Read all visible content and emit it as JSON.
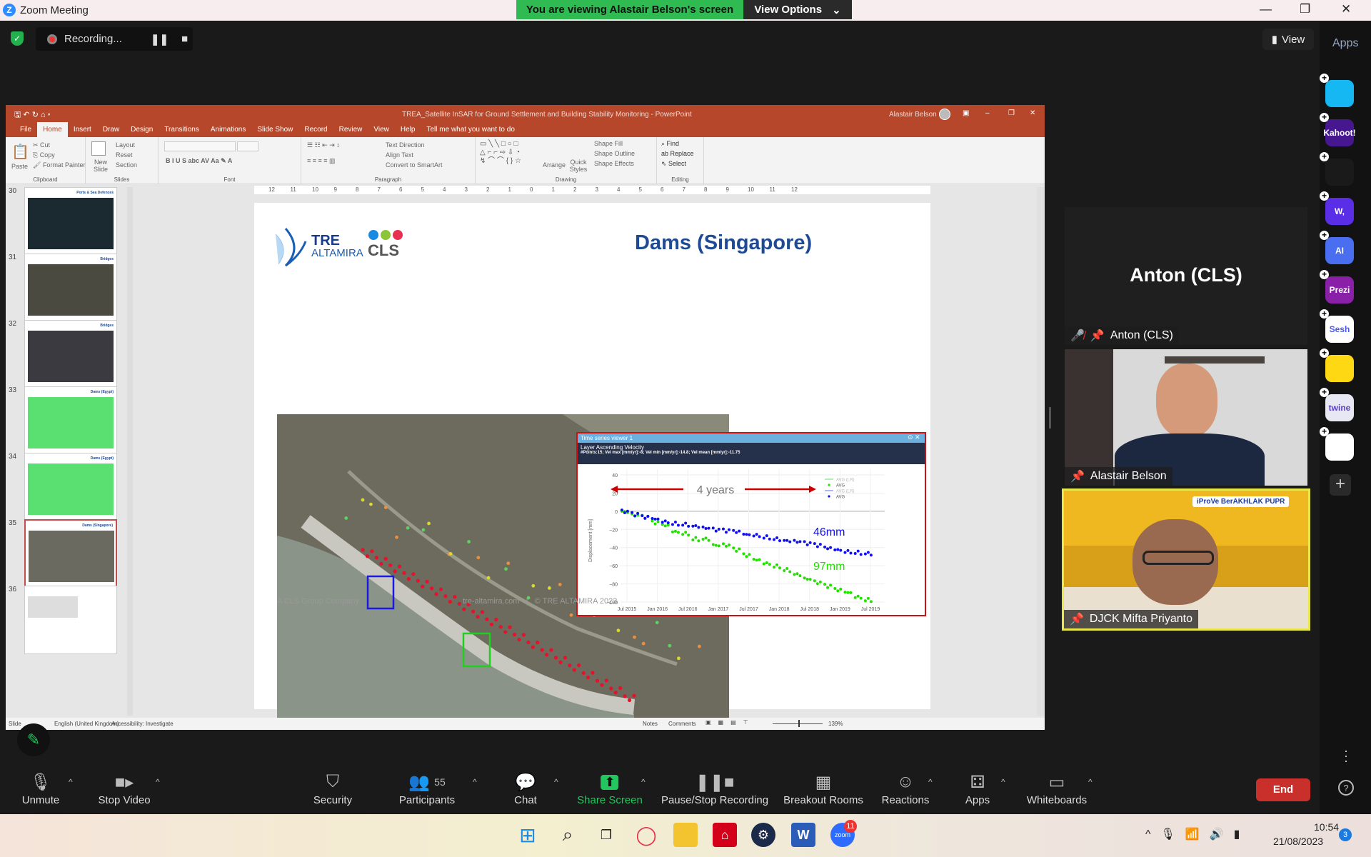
{
  "zoom": {
    "window_title": "Zoom Meeting",
    "banner": "You are viewing Alastair Belson's screen",
    "view_options": "View Options",
    "recording": "Recording...",
    "view_button": "View",
    "apps_label": "Apps",
    "colors": {
      "banner": "#2fbb52",
      "end": "#c9302c",
      "share": "#22c55e"
    },
    "apps": [
      {
        "name": "blue-arrow-app",
        "label": "",
        "bg": "#16b8f3",
        "fg": "#1a2a4a"
      },
      {
        "name": "kahoot-app",
        "label": "Kahoot!",
        "bg": "#46178f",
        "fg": "#fff"
      },
      {
        "name": "orange-c-app",
        "label": "",
        "bg": "#1a1a1a",
        "fg": "#ff5a26"
      },
      {
        "name": "wooclap-app",
        "label": "W,",
        "bg": "#5a2ee6",
        "fg": "#fff"
      },
      {
        "name": "ai-camera-app",
        "label": "AI",
        "bg": "#4a6ef0",
        "fg": "#fff"
      },
      {
        "name": "prezi-app",
        "label": "Prezi",
        "bg": "#8a1fa8",
        "fg": "#fff"
      },
      {
        "name": "sesh-app",
        "label": "Sesh",
        "bg": "#fff",
        "fg": "#4a5af0"
      },
      {
        "name": "emoji-app",
        "label": "",
        "bg": "#ffd814",
        "fg": "#222"
      },
      {
        "name": "twine-app",
        "label": "twine",
        "bg": "#e8e8f4",
        "fg": "#5a40c0"
      },
      {
        "name": "blocks-app",
        "label": "",
        "bg": "#fff",
        "fg": "#f09020"
      }
    ],
    "participants_tiles": [
      {
        "name": "Anton (CLS)",
        "muted": true
      },
      {
        "name": "Alastair Belson"
      },
      {
        "name": "DJCK Mifta Priyanto",
        "banner_logos": "iProVe BerAKHLAK PUPR"
      }
    ],
    "toolbar": [
      {
        "id": "unmute",
        "label": "Unmute",
        "icon": "microphone-muted-icon"
      },
      {
        "id": "stop-video",
        "label": "Stop Video",
        "icon": "video-camera-icon"
      },
      {
        "id": "security",
        "label": "Security",
        "icon": "shield-icon"
      },
      {
        "id": "participants",
        "label": "Participants",
        "icon": "people-icon",
        "count": "55"
      },
      {
        "id": "chat",
        "label": "Chat",
        "icon": "chat-bubble-icon"
      },
      {
        "id": "share-screen",
        "label": "Share Screen",
        "icon": "share-arrow-icon"
      },
      {
        "id": "pause-stop-recording",
        "label": "Pause/Stop Recording",
        "icon": "pause-stop-icon"
      },
      {
        "id": "breakout-rooms",
        "label": "Breakout Rooms",
        "icon": "grid-icon"
      },
      {
        "id": "reactions",
        "label": "Reactions",
        "icon": "smiley-icon"
      },
      {
        "id": "apps",
        "label": "Apps",
        "icon": "apps-icon"
      },
      {
        "id": "whiteboards",
        "label": "Whiteboards",
        "icon": "whiteboard-icon"
      }
    ],
    "end_label": "End"
  },
  "ppt": {
    "title": "TREA_Satellite InSAR for Ground Settlement and Building Stability Monitoring  -  PowerPoint",
    "user": "Alastair Belson",
    "tabs": [
      "File",
      "Home",
      "Insert",
      "Draw",
      "Design",
      "Transitions",
      "Animations",
      "Slide Show",
      "Record",
      "Review",
      "View",
      "Help"
    ],
    "active_tab": "Home",
    "tell_me": "Tell me what you want to do",
    "ribbon": {
      "clipboard": {
        "label": "Clipboard",
        "paste": "Paste",
        "cut": "Cut",
        "copy": "Copy",
        "format_painter": "Format Painter"
      },
      "slides": {
        "label": "Slides",
        "new_slide": "New Slide",
        "layout": "Layout",
        "reset": "Reset",
        "section": "Section"
      },
      "font": {
        "label": "Font"
      },
      "paragraph": {
        "label": "Paragraph",
        "text_direction": "Text Direction",
        "align_text": "Align Text",
        "smartart": "Convert to SmartArt"
      },
      "drawing": {
        "label": "Drawing",
        "arrange": "Arrange",
        "quick_styles": "Quick Styles",
        "shape_fill": "Shape Fill",
        "shape_outline": "Shape Outline",
        "shape_effects": "Shape Effects"
      },
      "editing": {
        "label": "Editing",
        "find": "Find",
        "replace": "Replace",
        "select": "Select"
      }
    },
    "ruler": [
      "12",
      "11",
      "10",
      "9",
      "8",
      "7",
      "6",
      "5",
      "4",
      "3",
      "2",
      "1",
      "0",
      "1",
      "2",
      "3",
      "4",
      "5",
      "6",
      "7",
      "8",
      "9",
      "10",
      "11",
      "12"
    ],
    "thumbnails": [
      {
        "num": "30",
        "title": "Ports & Sea Defences"
      },
      {
        "num": "31",
        "title": "Bridges"
      },
      {
        "num": "32",
        "title": "Bridges"
      },
      {
        "num": "33",
        "title": "Dams (Egypt)"
      },
      {
        "num": "34",
        "title": "Dams (Egypt)"
      },
      {
        "num": "35",
        "title": "Dams (Singapore)",
        "selected": true
      },
      {
        "num": "36",
        "title": ""
      }
    ],
    "status": {
      "slide": "Slide",
      "language": "English (United Kingdom)",
      "accessibility": "Accessibility: Investigate",
      "notes": "Notes",
      "comments": "Comments",
      "zoom": "139%"
    }
  },
  "slide": {
    "title": "Dams (Singapore)",
    "logo_tre": "TRE",
    "logo_altamira": "ALTAMIRA",
    "logo_cls": "CLS",
    "footer_left": "A CLS Group Company",
    "footer_center": "tre-altamira.com   |   © TRE ALTAMIRA 2023",
    "popup": {
      "title": "Time series viewer 1",
      "layer": "Layer Ascending Velocity",
      "stats": "#Points:15; Vel max [mm/yr]:-8; Vel min [mm/yr]:-14.8; Vel mean [mm/yr]:-11.75",
      "annotation": "4 years",
      "label_blue": "46mm",
      "label_green": "97mm"
    }
  },
  "chart_data": {
    "type": "scatter",
    "ylabel": "Displacement [mm]",
    "ylim": [
      -100,
      40
    ],
    "yticks": [
      "40",
      "20",
      "0",
      "−20",
      "−40",
      "−60",
      "−80",
      "−100"
    ],
    "xticks": [
      "Jul 2015",
      "Jan 2016",
      "Jul 2016",
      "Jan 2017",
      "Jul 2017",
      "Jan 2018",
      "Jul 2018",
      "Jan 2019",
      "Jul 2019"
    ],
    "legend": [
      "AVG (LR)",
      "AVG",
      "AVG (LR)",
      "AVG"
    ],
    "legend_placement": "top-right",
    "x": [
      "2015-06",
      "2015-08",
      "2015-10",
      "2015-12",
      "2016-02",
      "2016-04",
      "2016-06",
      "2016-08",
      "2016-10",
      "2016-12",
      "2017-02",
      "2017-04",
      "2017-06",
      "2017-08",
      "2017-10",
      "2017-12",
      "2018-02",
      "2018-04",
      "2018-06",
      "2018-08",
      "2018-10",
      "2018-12",
      "2019-02",
      "2019-04",
      "2019-06"
    ],
    "series": [
      {
        "name": "AVG",
        "color": "#22e000",
        "values": [
          0,
          -4,
          -6,
          -12,
          -15,
          -22,
          -24,
          -30,
          -30,
          -37,
          -37,
          -42,
          -48,
          -53,
          -57,
          -60,
          -64,
          -69,
          -74,
          -78,
          -82,
          -86,
          -89,
          -94,
          -97
        ]
      },
      {
        "name": "AVG",
        "color": "#1010ee",
        "values": [
          0,
          -3,
          -6,
          -8,
          -11,
          -13,
          -14,
          -16,
          -18,
          -20,
          -21,
          -22,
          -25,
          -26,
          -28,
          -30,
          -32,
          -33,
          -35,
          -37,
          -40,
          -42,
          -44,
          -45,
          -46
        ]
      }
    ]
  },
  "taskbar": {
    "time": "10:54",
    "date": "21/08/2023",
    "notifications": "3",
    "zoom_badge": "11"
  }
}
